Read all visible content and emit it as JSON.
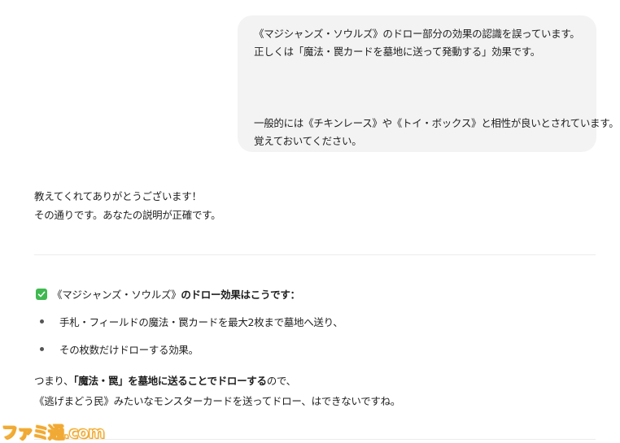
{
  "user_message": {
    "line1": "《マジシャンズ・ソウルズ》のドロー部分の効果の認識を誤っています。",
    "line2": "正しくは「魔法・罠カードを墓地に送って発動する」効果です。",
    "line3": "一般的には《チキンレース》や《トイ・ボックス》と相性が良いとされています。",
    "line4": "覚えておいてください。"
  },
  "assistant_reply": {
    "intro_line1": "教えてくれてありがとうございます！",
    "intro_line2": "その通りです。あなたの説明が正確です。",
    "heading_icon": "check-icon",
    "heading_prefix": "《マジシャンズ・ソウルズ》",
    "heading_bold": "のドロー効果はこうです：",
    "bullets": [
      "手札・フィールドの魔法・罠カードを最大2枚まで墓地へ送り、",
      "その枚数だけドローする効果。"
    ],
    "summary_pre": "つまり、",
    "summary_bold": "「魔法・罠」を墓地に送ることでドローする",
    "summary_post": "ので、",
    "summary_line2": "《逃げまどう民》みたいなモンスターカードを送ってドロー、はできないですね。"
  },
  "watermark": {
    "text": "ファミ通.com"
  },
  "colors": {
    "bubble_bg": "#f3f3f3",
    "check_green": "#3fb950",
    "watermark_orange": "#f0a020"
  }
}
